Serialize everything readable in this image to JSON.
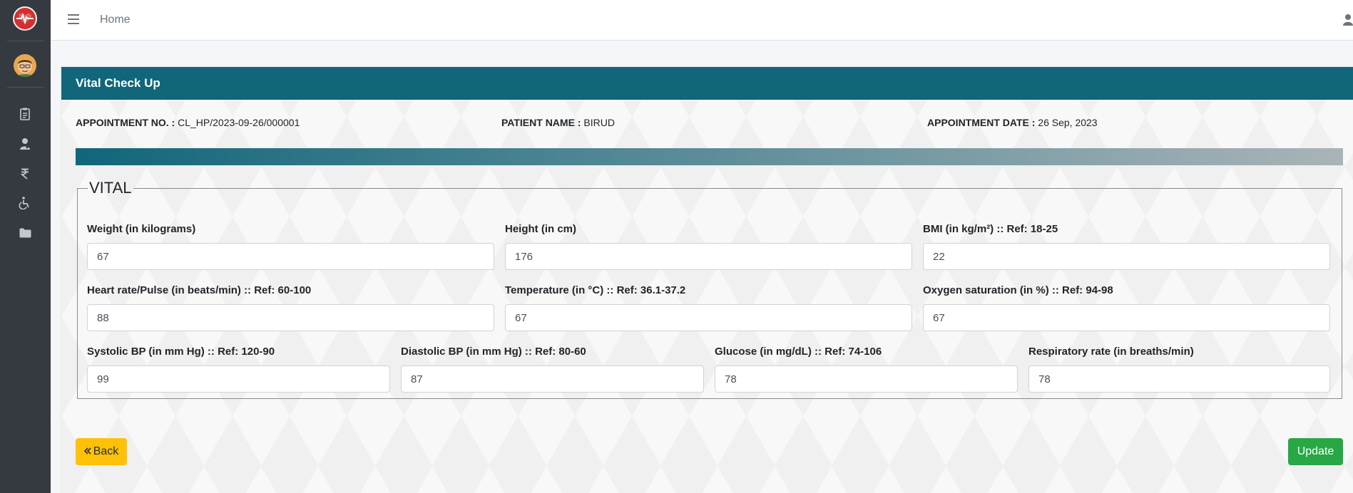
{
  "topbar": {
    "home_label": "Home"
  },
  "card": {
    "title": "Vital Check Up",
    "appointment_no_label": "APPOINTMENT NO. :",
    "appointment_no_value": "CL_HP/2023-09-26/000001",
    "patient_name_label": "PATIENT NAME :",
    "patient_name_value": "BIRUD",
    "appointment_date_label": "APPOINTMENT DATE :",
    "appointment_date_value": "26 Sep, 2023"
  },
  "vital": {
    "legend": "VITAL",
    "fields": [
      {
        "label": "Weight (in kilograms)",
        "value": "67"
      },
      {
        "label": "Height (in cm)",
        "value": "176"
      },
      {
        "label": "BMI (in kg/m²) :: Ref: 18-25",
        "value": "22"
      },
      {
        "label": "Heart rate/Pulse (in beats/min) :: Ref: 60-100",
        "value": "88"
      },
      {
        "label": "Temperature (in °C) :: Ref: 36.1-37.2",
        "value": "67"
      },
      {
        "label": "Oxygen saturation (in %) :: Ref: 94-98",
        "value": "67"
      },
      {
        "label": "Systolic BP (in mm Hg) :: Ref: 120-90",
        "value": "99"
      },
      {
        "label": "Diastolic BP (in mm Hg) :: Ref: 80-60",
        "value": "87"
      },
      {
        "label": "Glucose (in mg/dL) :: Ref: 74-106",
        "value": "78"
      },
      {
        "label": "Respiratory rate (in breaths/min)",
        "value": "78"
      }
    ]
  },
  "buttons": {
    "back_label": "Back",
    "update_label": "Update"
  },
  "icons": {
    "logo": "heartbeat-logo-icon",
    "avatar": "user-avatar",
    "nav": [
      "clipboard-icon",
      "user-doctor-icon",
      "rupee-icon",
      "wheelchair-icon",
      "folder-icon"
    ],
    "hamburger": "bars-icon",
    "user": "user-icon",
    "back": "double-chevron-left-icon"
  },
  "colors": {
    "primary": "#11667a",
    "sidebar": "#343a40",
    "back_button": "#ffc107",
    "update_button": "#28a745"
  }
}
